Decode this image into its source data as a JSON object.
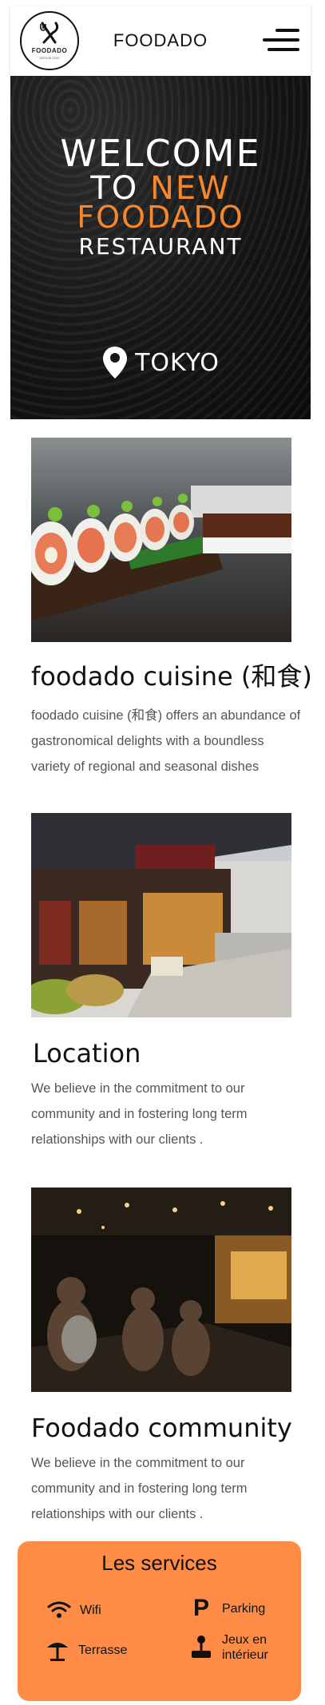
{
  "header": {
    "logo_name": "FOODADO",
    "logo_tagline": "DEPUIS 2019",
    "title": "FOODADO",
    "menu_icon": "hamburger-menu-icon"
  },
  "hero": {
    "line1": "WELCOME",
    "line2_white": "TO",
    "line2_orange": "NEW",
    "line3": "FOODADO",
    "line4": "RESTAURANT",
    "location": "TOKYO",
    "location_icon": "map-pin-icon",
    "accent_color": "#f7872d"
  },
  "cards": [
    {
      "image_alt": "sushi rolls on a board",
      "title": "foodado cuisine (和食)",
      "text": "foodado cuisine (和食)  offers an abundance of gastronomical delights with a boundless variety of regional and seasonal dishes"
    },
    {
      "image_alt": "traditional japanese street storefront",
      "title": "Location",
      "text": "We believe in the commitment to our community and in fostering long term relationships with our clients  ."
    },
    {
      "image_alt": "busy restaurant interior with diners",
      "title": "Foodado community",
      "text": "We believe in the commitment to our community and in fostering long term relationships with our clients  ."
    }
  ],
  "services": {
    "title": "Les services",
    "background": "#fe8c46",
    "items": [
      {
        "label": "Wifi",
        "icon": "wifi-icon"
      },
      {
        "label": "Parking",
        "icon": "parking-icon"
      },
      {
        "label": "Terrasse",
        "icon": "umbrella-icon"
      },
      {
        "label": "Jeux en intérieur",
        "icon": "joystick-icon"
      }
    ]
  }
}
